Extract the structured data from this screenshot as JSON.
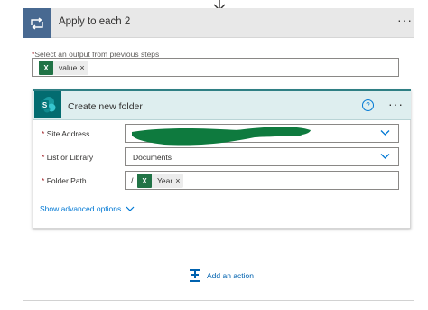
{
  "outer": {
    "title": "Apply to each 2",
    "more_label": "···",
    "icon": "loop-icon",
    "select_label": "Select an output from previous steps",
    "select_required": "*",
    "token": {
      "label": "value",
      "close": "×",
      "icon": "excel-icon"
    }
  },
  "action": {
    "title": "Create new folder",
    "help_label": "?",
    "more_label": "···",
    "icon": "sharepoint-icon",
    "fields": [
      {
        "required": "*",
        "label": "Site Address",
        "value": ""
      },
      {
        "required": "*",
        "label": "List or Library",
        "value": "Documents"
      },
      {
        "required": "*",
        "label": "Folder Path",
        "prefix": "/",
        "token": {
          "label": "Year",
          "close": "×",
          "icon": "excel-icon"
        }
      }
    ],
    "show_advanced": "Show advanced options"
  },
  "add_action": {
    "label": "Add an action",
    "icon": "add-action-icon"
  },
  "colors": {
    "loop_header": "#486991",
    "sharepoint": "#036c70",
    "excel": "#217346",
    "link": "#0078d4",
    "redaction": "#0e7a3e"
  }
}
